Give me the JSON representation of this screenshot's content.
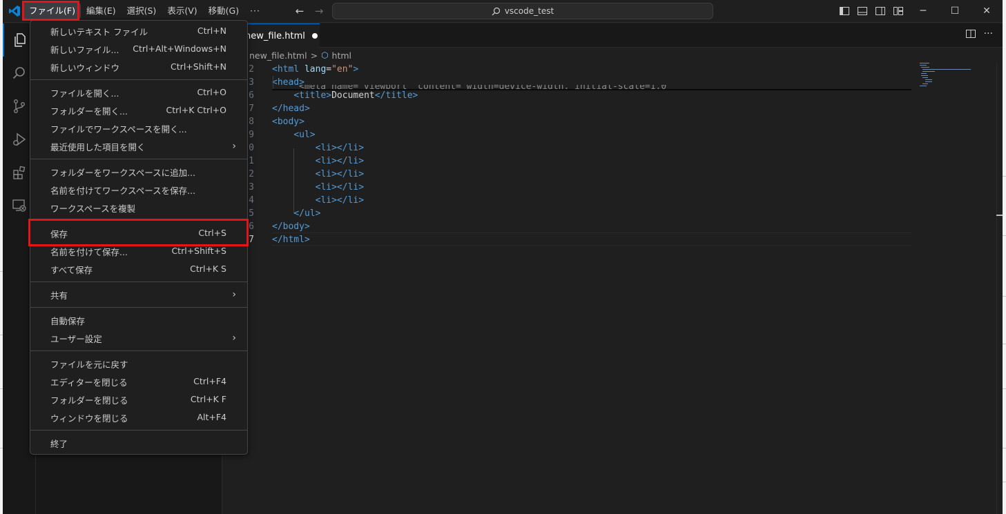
{
  "menubar": {
    "items": [
      "ファイル(F)",
      "編集(E)",
      "選択(S)",
      "表示(V)",
      "移動(G)"
    ],
    "more": "···"
  },
  "search": {
    "text": "vscode_test"
  },
  "editor": {
    "tab": {
      "label": "new_file.html"
    },
    "breadcrumb": {
      "file": "new_file.html",
      "separator": ">",
      "symbol": "html"
    },
    "lines": [
      {
        "n": "2",
        "html": "<span class='tag'>&lt;html</span> <span class='attr'>lang</span><span class='plain'>=</span><span class='str'>\"en\"</span><span class='tag'>&gt;</span>"
      },
      {
        "n": "3",
        "html": "<span class='tag'>&lt;head&gt;</span>"
      },
      {
        "n": "6",
        "html": "    <span class='tag'>&lt;title&gt;</span><span class='plain'>Document</span><span class='tag'>&lt;/title&gt;</span>"
      },
      {
        "n": "7",
        "html": "<span class='tag'>&lt;/head&gt;</span>"
      },
      {
        "n": "8",
        "html": "<span class='tag'>&lt;body&gt;</span>"
      },
      {
        "n": "9",
        "html": "    <span class='tag'>&lt;ul&gt;</span>"
      },
      {
        "n": "0",
        "html": "        <span class='tag'>&lt;li&gt;&lt;/li&gt;</span>"
      },
      {
        "n": "1",
        "html": "        <span class='tag'>&lt;li&gt;&lt;/li&gt;</span>"
      },
      {
        "n": "2",
        "html": "        <span class='tag'>&lt;li&gt;&lt;/li&gt;</span>"
      },
      {
        "n": "3",
        "html": "        <span class='tag'>&lt;li&gt;&lt;/li&gt;</span>"
      },
      {
        "n": "4",
        "html": "        <span class='tag'>&lt;li&gt;&lt;/li&gt;</span>"
      },
      {
        "n": "5",
        "html": "    <span class='tag'>&lt;/ul&gt;</span>"
      },
      {
        "n": "6",
        "html": "<span class='tag'>&lt;/body&gt;</span>"
      },
      {
        "n": "7",
        "html": "<span class='tag'>&lt;/html&gt;</span>",
        "current": true
      }
    ]
  },
  "file_menu": {
    "groups": [
      [
        {
          "label": "新しいテキスト ファイル",
          "shortcut": "Ctrl+N"
        },
        {
          "label": "新しいファイル...",
          "shortcut": "Ctrl+Alt+Windows+N"
        },
        {
          "label": "新しいウィンドウ",
          "shortcut": "Ctrl+Shift+N"
        }
      ],
      [
        {
          "label": "ファイルを開く...",
          "shortcut": "Ctrl+O"
        },
        {
          "label": "フォルダーを開く...",
          "shortcut": "Ctrl+K Ctrl+O"
        },
        {
          "label": "ファイルでワークスペースを開く...",
          "shortcut": ""
        },
        {
          "label": "最近使用した項目を開く",
          "shortcut": "",
          "submenu": true
        }
      ],
      [
        {
          "label": "フォルダーをワークスペースに追加...",
          "shortcut": ""
        },
        {
          "label": "名前を付けてワークスペースを保存...",
          "shortcut": ""
        },
        {
          "label": "ワークスペースを複製",
          "shortcut": ""
        }
      ],
      [
        {
          "label": "保存",
          "shortcut": "Ctrl+S"
        },
        {
          "label": "名前を付けて保存...",
          "shortcut": "Ctrl+Shift+S"
        },
        {
          "label": "すべて保存",
          "shortcut": "Ctrl+K S"
        }
      ],
      [
        {
          "label": "共有",
          "shortcut": "",
          "submenu": true
        }
      ],
      [
        {
          "label": "自動保存",
          "shortcut": ""
        },
        {
          "label": "ユーザー設定",
          "shortcut": "",
          "submenu": true
        }
      ],
      [
        {
          "label": "ファイルを元に戻す",
          "shortcut": ""
        },
        {
          "label": "エディターを閉じる",
          "shortcut": "Ctrl+F4"
        },
        {
          "label": "フォルダーを閉じる",
          "shortcut": "Ctrl+K F"
        },
        {
          "label": "ウィンドウを閉じる",
          "shortcut": "Alt+F4"
        }
      ],
      [
        {
          "label": "終了",
          "shortcut": ""
        }
      ]
    ]
  },
  "colors": {
    "accent": "#0078d4",
    "highlight": "#e5141a",
    "tag": "#569cd6",
    "attr": "#9cdcfe",
    "string": "#ce9178"
  }
}
